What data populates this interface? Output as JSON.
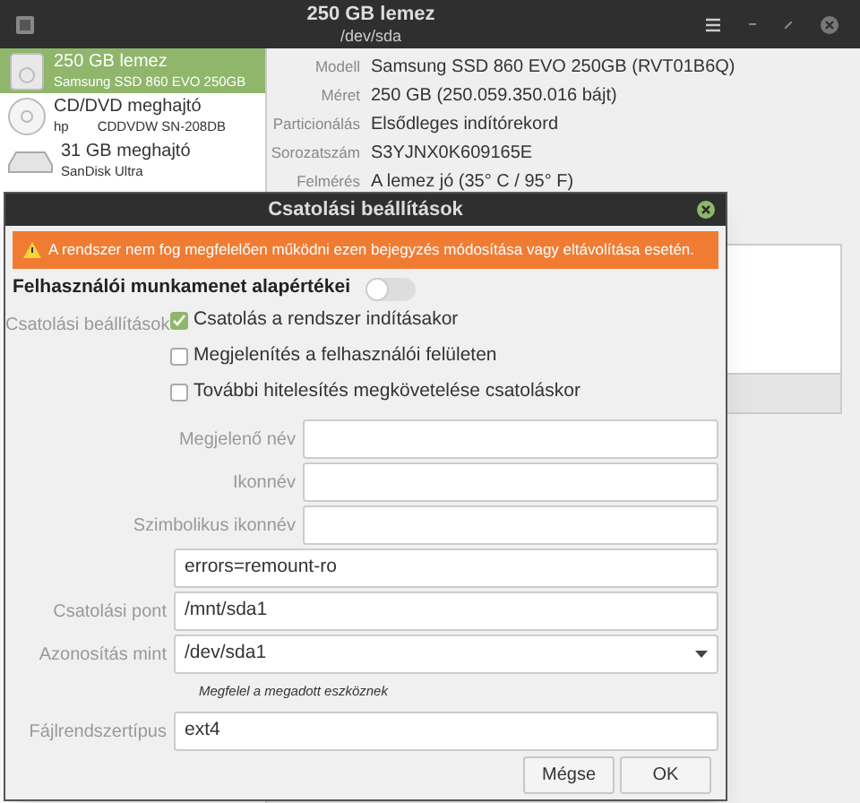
{
  "window": {
    "title": "250 GB lemez",
    "subtitle": "/dev/sda"
  },
  "drives": [
    {
      "kind": "disk",
      "name": "250 GB lemez",
      "info": [
        "Samsung SSD 860 EVO 250GB"
      ],
      "selected": true
    },
    {
      "kind": "optical",
      "name": "CD/DVD meghajtó",
      "info": [
        "hp",
        "CDDVDW SN-208DB"
      ],
      "selected": false
    },
    {
      "kind": "usb",
      "name": "31 GB meghajtó",
      "info": [
        "SanDisk Ultra"
      ],
      "selected": false
    }
  ],
  "details": [
    {
      "label": "Modell",
      "value": "Samsung SSD 860 EVO 250GB (RVT01B6Q)"
    },
    {
      "label": "Méret",
      "value": "250 GB (250.059.350.016 bájt)"
    },
    {
      "label": "Particionálás",
      "value": "Elsődleges indítórekord"
    },
    {
      "label": "Sorozatszám",
      "value": "S3YJNX0K609165E"
    },
    {
      "label": "Felmérés",
      "value": "A lemez jó (35° C / 95° F)"
    }
  ],
  "dialog": {
    "title": "Csatolási beállítások",
    "warning": "A rendszer nem fog megfelelően működni ezen bejegyzés módosítása vagy eltávolítása esetén.",
    "session_defaults": {
      "label": "Felhasználói munkamenet alapértékei",
      "on": false
    },
    "options_label": "Csatolási beállítások",
    "checks": [
      {
        "label": "Csatolás a rendszer indításakor",
        "checked": true
      },
      {
        "label": "Megjelenítés a felhasználói felületen",
        "checked": false
      },
      {
        "label": "További hitelesítés megkövetelése csatoláskor",
        "checked": false
      }
    ],
    "named_fields": [
      {
        "label": "Megjelenő név"
      },
      {
        "label": "Ikonnév"
      },
      {
        "label": "Szimbolikus ikonnév"
      }
    ],
    "fields": [
      {
        "kind": "text",
        "value": "errors=remount-ro"
      },
      {
        "kind": "text",
        "label": "Csatolási pont",
        "value": "/mnt/sda1"
      },
      {
        "kind": "select",
        "label": "Azonosítás mint",
        "value": "/dev/sda1",
        "hint": "Megfelel a megadott eszköznek"
      },
      {
        "kind": "text",
        "label": "Fájlrendszertípus",
        "value": "ext4"
      }
    ],
    "buttons": [
      "Mégse",
      "OK"
    ]
  }
}
